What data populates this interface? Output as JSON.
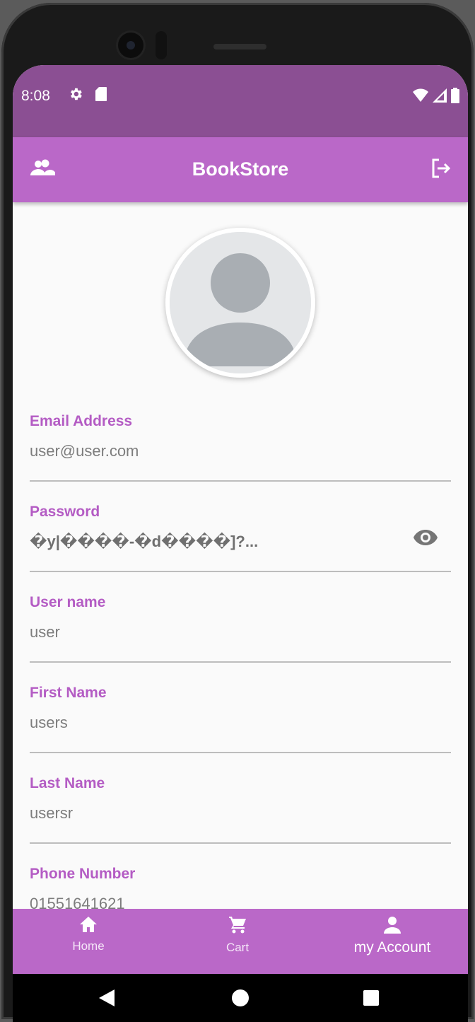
{
  "status_bar": {
    "time": "8:08",
    "icons_left": [
      "settings-icon",
      "sd-card-icon"
    ],
    "icons_right": [
      "wifi-icon",
      "signal-icon",
      "battery-icon"
    ]
  },
  "app_bar": {
    "title": "BookStore",
    "left_icon": "people-icon",
    "right_icon": "logout-icon",
    "color": "#ba68c8"
  },
  "avatar": {
    "icon": "person-placeholder-icon"
  },
  "fields": [
    {
      "label": "Email Address",
      "value": "user@user.com"
    },
    {
      "label": "Password",
      "value": "�y|����-�d����]?...",
      "trailing_icon": "eye-icon"
    },
    {
      "label": "User name",
      "value": "user"
    },
    {
      "label": "First Name",
      "value": "users"
    },
    {
      "label": "Last Name",
      "value": "usersr"
    },
    {
      "label": "Phone Number",
      "value": "01551641621"
    }
  ],
  "bottom_nav": {
    "items": [
      {
        "label": "Home",
        "icon": "home-icon"
      },
      {
        "label": "Cart",
        "icon": "cart-icon"
      },
      {
        "label": "my Account",
        "icon": "account-icon",
        "active": true
      }
    ]
  },
  "colors": {
    "status_bar": "#8b4f93",
    "primary": "#ba68c8",
    "label": "#b45cc4"
  }
}
